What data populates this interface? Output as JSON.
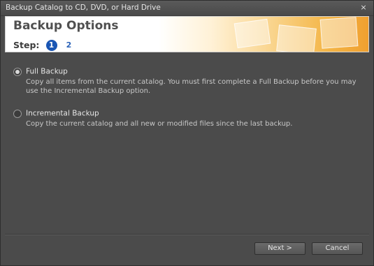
{
  "window": {
    "title": "Backup Catalog to CD, DVD, or Hard Drive",
    "close_glyph": "×"
  },
  "header": {
    "title": "Backup Options",
    "step_label": "Step:",
    "steps": [
      "1",
      "2"
    ],
    "current_step": "1",
    "accent_color": "#1a56b4"
  },
  "options": [
    {
      "label": "Full Backup",
      "selected": true,
      "description": "Copy all items from the current catalog. You must first complete a Full Backup before you may use the Incremental Backup option."
    },
    {
      "label": "Incremental Backup",
      "selected": false,
      "description": "Copy the current catalog and all new or modified files since the last backup."
    }
  ],
  "footer": {
    "next_label": "Next >",
    "cancel_label": "Cancel"
  }
}
